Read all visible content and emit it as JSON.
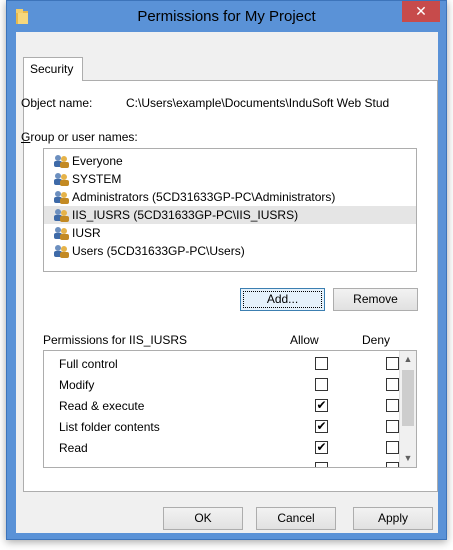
{
  "window": {
    "title": "Permissions for My Project",
    "close_label": "✕"
  },
  "tabs": [
    {
      "label": "Security"
    }
  ],
  "object": {
    "label": "Object name:",
    "value": "C:\\Users\\example\\Documents\\InduSoft Web Stud"
  },
  "groups": {
    "label": "Group or user names:",
    "items": [
      {
        "label": "Everyone"
      },
      {
        "label": "SYSTEM"
      },
      {
        "label": "Administrators (5CD31633GP-PC\\Administrators)"
      },
      {
        "label": "IIS_IUSRS (5CD31633GP-PC\\IIS_IUSRS)",
        "selected": true
      },
      {
        "label": "IUSR"
      },
      {
        "label": "Users (5CD31633GP-PC\\Users)"
      }
    ]
  },
  "buttons": {
    "add": "Add...",
    "remove": "Remove",
    "ok": "OK",
    "cancel": "Cancel",
    "apply": "Apply"
  },
  "permissions": {
    "label": "Permissions for IIS_IUSRS",
    "allow_header": "Allow",
    "deny_header": "Deny",
    "rows": [
      {
        "name": "Full control",
        "allow": false,
        "deny": false
      },
      {
        "name": "Modify",
        "allow": false,
        "deny": false
      },
      {
        "name": "Read & execute",
        "allow": true,
        "deny": false
      },
      {
        "name": "List folder contents",
        "allow": true,
        "deny": false
      },
      {
        "name": "Read",
        "allow": true,
        "deny": false
      },
      {
        "name": "",
        "allow": false,
        "deny": false
      }
    ]
  },
  "icons": {
    "folder": "folder-icon",
    "users": "users-icon",
    "scroll_up": "chevron-up-icon",
    "scroll_down": "chevron-down-icon"
  },
  "colors": {
    "titlebar": "#5a92d7",
    "close_button": "#c74b4b",
    "selection": "#e5e5e5"
  }
}
